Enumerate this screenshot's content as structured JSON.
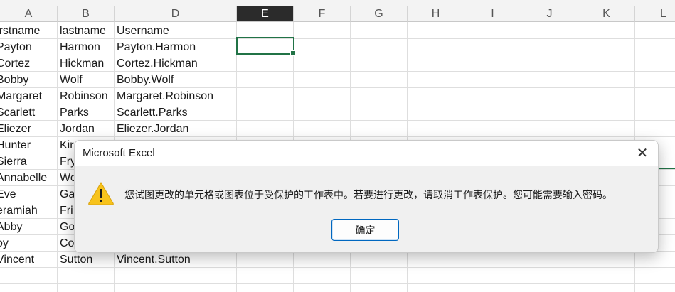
{
  "spreadsheet": {
    "columns": [
      "A",
      "B",
      "D",
      "E",
      "F",
      "G",
      "H",
      "I",
      "J",
      "K",
      "L"
    ],
    "selected_column": "E",
    "header_row": {
      "a": "irstname",
      "b": "lastname",
      "d": "Username"
    },
    "rows": [
      {
        "a": "Payton",
        "b": "Harmon",
        "d": "Payton.Harmon"
      },
      {
        "a": "Cortez",
        "b": "Hickman",
        "d": "Cortez.Hickman"
      },
      {
        "a": "Bobby",
        "b": "Wolf",
        "d": "Bobby.Wolf"
      },
      {
        "a": "Margaret",
        "b": "Robinson",
        "d": "Margaret.Robinson"
      },
      {
        "a": "Scarlett",
        "b": "Parks",
        "d": "Scarlett.Parks"
      },
      {
        "a": "Eliezer",
        "b": "Jordan",
        "d": "Eliezer.Jordan"
      },
      {
        "a": "Hunter",
        "b": "Kir",
        "d": ""
      },
      {
        "a": "Sierra",
        "b": "Fry",
        "d": ""
      },
      {
        "a": "Annabelle",
        "b": "We",
        "d": ""
      },
      {
        "a": "Eve",
        "b": "Ga",
        "d": ""
      },
      {
        "a": "eramiah",
        "b": "Fri",
        "d": ""
      },
      {
        "a": "Abby",
        "b": "Go",
        "d": ""
      },
      {
        "a": "oy",
        "b": "Co",
        "d": ""
      },
      {
        "a": "Vincent",
        "b": "Sutton",
        "d": "Vincent.Sutton"
      }
    ]
  },
  "dialog": {
    "title": "Microsoft Excel",
    "close_glyph": "✕",
    "message": "您试图更改的单元格或图表位于受保护的工作表中。若要进行更改，请取消工作表保护。您可能需要输入密码。",
    "ok_label": "确定",
    "icon": "warning-icon"
  },
  "colors": {
    "accent": "#217346",
    "button_border": "#0067c0",
    "warning": "#f7c31c"
  }
}
